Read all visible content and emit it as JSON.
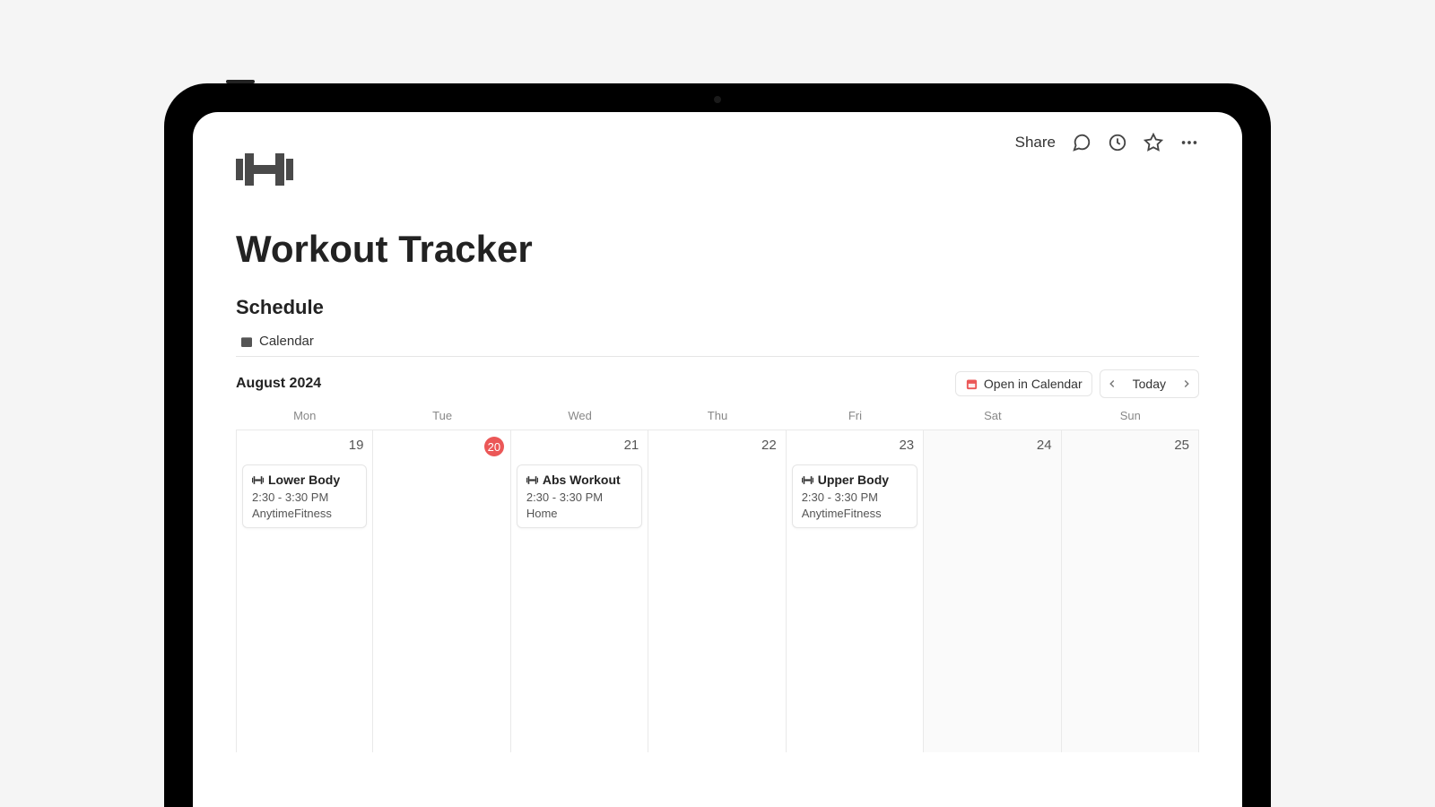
{
  "topbar": {
    "share": "Share"
  },
  "page": {
    "title": "Workout Tracker",
    "section": "Schedule"
  },
  "view": {
    "tab_label": "Calendar"
  },
  "calendar": {
    "month": "August 2024",
    "open_label": "Open in Calendar",
    "today_label": "Today",
    "weekdays": [
      "Mon",
      "Tue",
      "Wed",
      "Thu",
      "Fri",
      "Sat",
      "Sun"
    ],
    "days": [
      {
        "num": "19",
        "today": false,
        "weekend": false
      },
      {
        "num": "20",
        "today": true,
        "weekend": false
      },
      {
        "num": "21",
        "today": false,
        "weekend": false
      },
      {
        "num": "22",
        "today": false,
        "weekend": false
      },
      {
        "num": "23",
        "today": false,
        "weekend": false
      },
      {
        "num": "24",
        "today": false,
        "weekend": true
      },
      {
        "num": "25",
        "today": false,
        "weekend": true
      }
    ],
    "events": [
      {
        "day_index": 0,
        "title": "Lower Body",
        "time": "2:30 - 3:30 PM",
        "location": "AnytimeFitness"
      },
      {
        "day_index": 2,
        "title": "Abs Workout",
        "time": "2:30 - 3:30 PM",
        "location": "Home"
      },
      {
        "day_index": 4,
        "title": "Upper Body",
        "time": "2:30 - 3:30 PM",
        "location": "AnytimeFitness"
      }
    ]
  }
}
